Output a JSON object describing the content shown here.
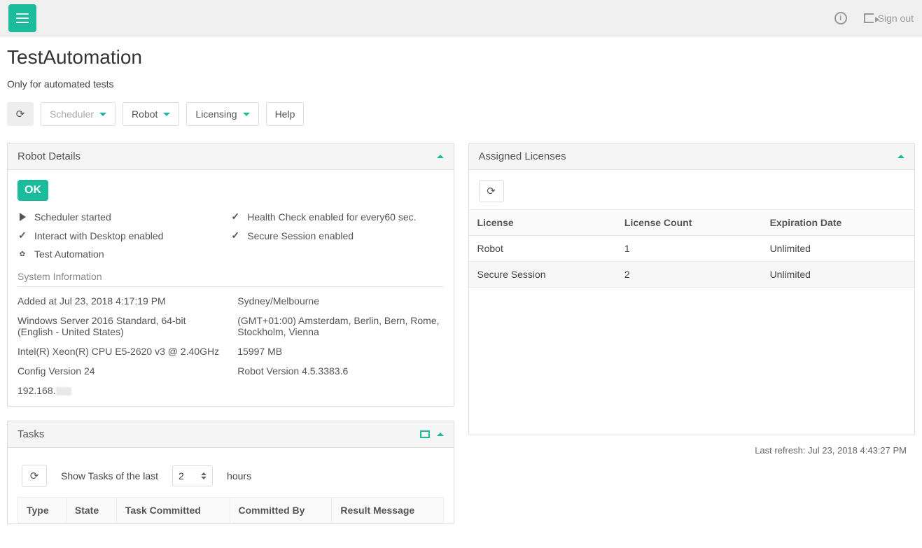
{
  "topbar": {
    "signout": "Sign out"
  },
  "page": {
    "title": "TestAutomation",
    "subtitle": "Only for automated tests"
  },
  "toolbar": {
    "scheduler": "Scheduler",
    "robot": "Robot",
    "licensing": "Licensing",
    "help": "Help"
  },
  "robot_details": {
    "header": "Robot Details",
    "status_badge": "OK",
    "status": {
      "scheduler": "Scheduler started",
      "health": "Health Check enabled for every60 sec.",
      "interact": "Interact with Desktop enabled",
      "secure": "Secure Session enabled",
      "automation": "Test Automation"
    },
    "sysinfo_title": "System Information",
    "info": {
      "added": "Added at Jul 23, 2018 4:17:19 PM",
      "tz_city": "Sydney/Melbourne",
      "os": "Windows Server 2016 Standard, 64-bit (English - United States)",
      "tz_offset": "(GMT+01:00) Amsterdam, Berlin, Bern, Rome, Stockholm, Vienna",
      "cpu": "Intel(R) Xeon(R) CPU E5-2620 v3 @ 2.40GHz",
      "mem": "15997 MB",
      "config": "Config Version 24",
      "rversion": "Robot Version 4.5.3383.6",
      "ip_prefix": "192.168."
    }
  },
  "licenses": {
    "header": "Assigned Licenses",
    "columns": {
      "license": "License",
      "count": "License Count",
      "exp": "Expiration Date"
    },
    "rows": [
      {
        "license": "Robot",
        "count": "1",
        "exp": "Unlimited"
      },
      {
        "license": "Secure Session",
        "count": "2",
        "exp": "Unlimited"
      }
    ],
    "footer": "Last refresh: Jul 23, 2018 4:43:27 PM"
  },
  "tasks": {
    "header": "Tasks",
    "show_label": "Show Tasks of the last",
    "hours_value": "2",
    "hours_unit": "hours",
    "columns": {
      "type": "Type",
      "state": "State",
      "committed": "Task Committed",
      "by": "Committed By",
      "result": "Result Message"
    }
  }
}
